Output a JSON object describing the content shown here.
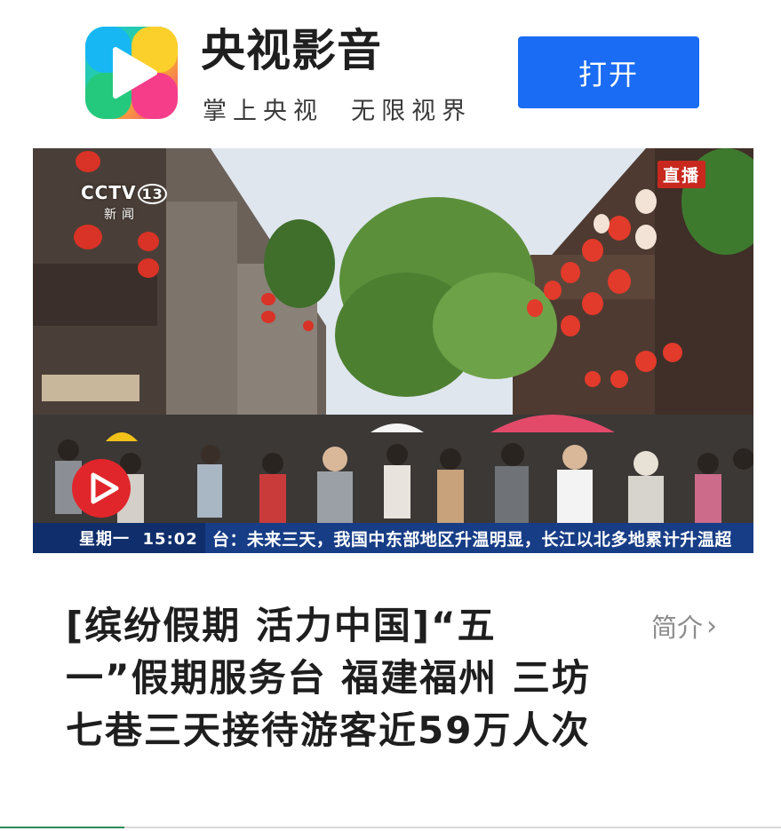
{
  "banner": {
    "app_name": "央视影音",
    "slogan": "掌上央视  无限视界",
    "open_button_label": "打开",
    "logo_icon": "cctv-video-app-logo",
    "accent_color": "#1a6cf5"
  },
  "video": {
    "channel_logo": "CCTV",
    "channel_number": "13",
    "channel_subtitle": "新闻",
    "live_badge": "直播",
    "ticker_time": "星期一  15:02",
    "ticker_text": "台：未来三天，我国中东部地区升温明显，长江以北多地累计升温超",
    "play_icon": "play-icon"
  },
  "article": {
    "title": "[缤纷假期  活力中国]“五一”假期服务台 福建福州 三坊七巷三天接待游客近59万人次",
    "intro_label": "简介",
    "intro_icon": "chevron-right-icon"
  }
}
